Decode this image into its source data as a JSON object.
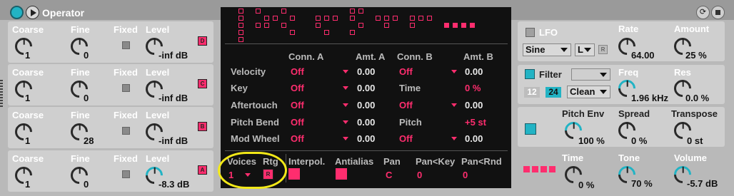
{
  "device": {
    "title": "Operator",
    "refresh_glyph": "⟳"
  },
  "operators": [
    {
      "coarse_label": "Coarse",
      "fine_label": "Fine",
      "fixed_label": "Fixed",
      "level_label": "Level",
      "coarse": "1",
      "fine": "0",
      "level": "-inf dB",
      "letter": "D"
    },
    {
      "coarse_label": "Coarse",
      "fine_label": "Fine",
      "fixed_label": "Fixed",
      "level_label": "Level",
      "coarse": "1",
      "fine": "0",
      "level": "-inf dB",
      "letter": "C"
    },
    {
      "coarse_label": "Coarse",
      "fine_label": "Fine",
      "fixed_label": "Fixed",
      "level_label": "Level",
      "coarse": "1",
      "fine": "28",
      "level": "-inf dB",
      "letter": "B"
    },
    {
      "coarse_label": "Coarse",
      "fine_label": "Fine",
      "fixed_label": "Fixed",
      "level_label": "Level",
      "coarse": "1",
      "fine": "0",
      "level": "-8.3 dB",
      "letter": "A"
    }
  ],
  "matrix": {
    "headers": [
      "Conn. A",
      "Amt. A",
      "Conn. B",
      "Amt. B"
    ],
    "rows": [
      {
        "label": "Velocity",
        "conn_a": "Off",
        "amt_a": "0.00",
        "conn_b": "Off",
        "amt_b": "0.00"
      },
      {
        "label": "Key",
        "conn_a": "Off",
        "amt_a": "0.00",
        "conn_b": "Time",
        "amt_b": "0 %"
      },
      {
        "label": "Aftertouch",
        "conn_a": "Off",
        "amt_a": "0.00",
        "conn_b": "Off",
        "amt_b": "0.00"
      },
      {
        "label": "Pitch Bend",
        "conn_a": "Off",
        "amt_a": "0.00",
        "conn_b": "Pitch",
        "amt_b": "+5 st"
      },
      {
        "label": "Mod Wheel",
        "conn_a": "Off",
        "amt_a": "0.00",
        "conn_b": "Off",
        "amt_b": "0.00"
      }
    ],
    "bottom": {
      "voices_label": "Voices",
      "voices": "1",
      "rtg_label": "Rtg",
      "rtg_btn": "R",
      "interpol_label": "Interpol.",
      "antialias_label": "Antialias",
      "pan_label": "Pan",
      "pan": "C",
      "pan_key_label": "Pan<Key",
      "pan_key": "0",
      "pan_rnd_label": "Pan<Rnd",
      "pan_rnd": "0"
    }
  },
  "lfo": {
    "label": "LFO",
    "wave": "Sine",
    "dest": "L",
    "r_btn": "R",
    "rate_label": "Rate",
    "rate": "64.00",
    "amount_label": "Amount",
    "amount": "25 %"
  },
  "filter": {
    "label": "Filter",
    "slope_12": "12",
    "slope_24": "24",
    "mode": "Clean",
    "freq_label": "Freq",
    "freq": "1.96 kHz",
    "res_label": "Res",
    "res": "0.0 %"
  },
  "pitch": {
    "env_label": "Pitch Env",
    "env": "100 %",
    "spread_label": "Spread",
    "spread": "0 %",
    "transpose_label": "Transpose",
    "transpose": "0 st"
  },
  "global": {
    "time_label": "Time",
    "time": "0 %",
    "tone_label": "Tone",
    "tone": "70 %",
    "volume_label": "Volume",
    "volume": "-5.7 dB"
  }
}
